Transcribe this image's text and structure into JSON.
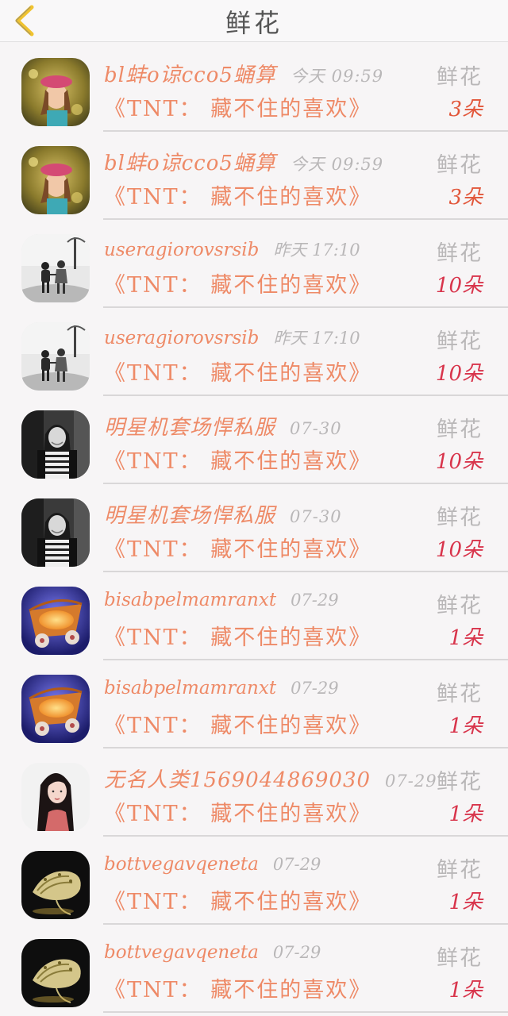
{
  "header": {
    "title": "鲜花",
    "back_icon": "chevron-left-icon",
    "back_color": "#f0c330"
  },
  "colors": {
    "name": "#ee8a67",
    "muted": "#b9b7b8",
    "count_orange": "#e2573b",
    "count_red": "#d8344b"
  },
  "records": [
    {
      "user": "bl蚌o谅cco5蛹算",
      "time": "今天 09:59",
      "gift": "《TNT： 藏不住的喜欢》",
      "type": "鲜花",
      "count": "3朵",
      "avatar": "girl-pink-hat"
    },
    {
      "user": "bl蚌o谅cco5蛹算",
      "time": "今天 09:59",
      "gift": "《TNT： 藏不住的喜欢》",
      "type": "鲜花",
      "count": "3朵",
      "avatar": "girl-pink-hat"
    },
    {
      "user": "useragiorovsrsib",
      "time": "昨天 17:10",
      "gift": "《TNT： 藏不住的喜欢》",
      "type": "鲜花",
      "count": "10朵",
      "avatar": "kids-walking"
    },
    {
      "user": "useragiorovsrsib",
      "time": "昨天 17:10",
      "gift": "《TNT： 藏不住的喜欢》",
      "type": "鲜花",
      "count": "10朵",
      "avatar": "kids-walking"
    },
    {
      "user": "明星机套场悍私服",
      "time": "07-30",
      "gift": "《TNT： 藏不住的喜欢》",
      "type": "鲜花",
      "count": "10朵",
      "avatar": "woman-bw"
    },
    {
      "user": "明星机套场悍私服",
      "time": "07-30",
      "gift": "《TNT： 藏不住的喜欢》",
      "type": "鲜花",
      "count": "10朵",
      "avatar": "woman-bw"
    },
    {
      "user": "bisabpelmamranxt",
      "time": "07-29",
      "gift": "《TNT： 藏不住的喜欢》",
      "type": "鲜花",
      "count": "1朵",
      "avatar": "orange-cart"
    },
    {
      "user": "bisabpelmamranxt",
      "time": "07-29",
      "gift": "《TNT： 藏不住的喜欢》",
      "type": "鲜花",
      "count": "1朵",
      "avatar": "orange-cart"
    },
    {
      "user": "无名人类1569044869030",
      "time": "07-29",
      "gift": "《TNT： 藏不住的喜欢》",
      "type": "鲜花",
      "count": "1朵",
      "avatar": "woman-long-hair"
    },
    {
      "user": "bottvegavqeneta",
      "time": "07-29",
      "gift": "《TNT： 藏不住的喜欢》",
      "type": "鲜花",
      "count": "1朵",
      "avatar": "seashell"
    },
    {
      "user": "bottvegavqeneta",
      "time": "07-29",
      "gift": "《TNT： 藏不住的喜欢》",
      "type": "鲜花",
      "count": "1朵",
      "avatar": "seashell"
    }
  ]
}
